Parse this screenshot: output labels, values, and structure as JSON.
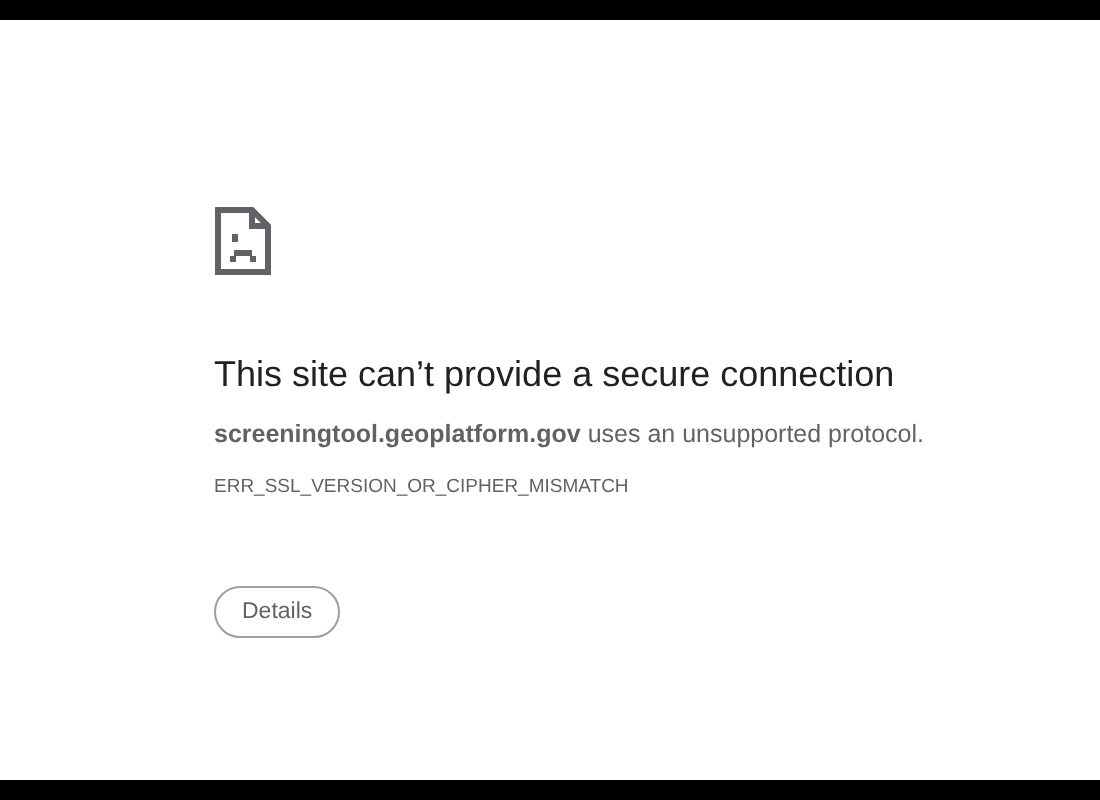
{
  "error_page": {
    "heading": "This site can’t provide a secure connection",
    "message": "**screeningtool.geoplatform.gov** uses an unsupported protocol.",
    "error_code": "ERR_SSL_VERSION_OR_CIPHER_MISMATCH",
    "details_button": "Details"
  }
}
